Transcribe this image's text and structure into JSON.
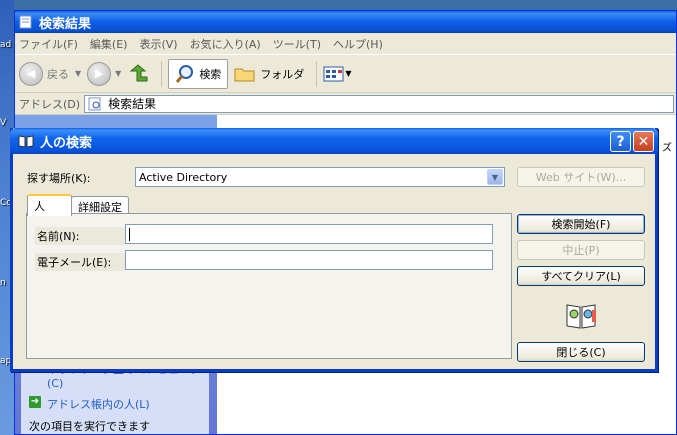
{
  "desktop": {
    "labels": [
      "ad",
      "V",
      "Cc",
      "n",
      "ap"
    ]
  },
  "explorer": {
    "title": "検索結果",
    "menu": [
      "ファイル(F)",
      "編集(E)",
      "表示(V)",
      "お気に入り(A)",
      "ツール(T)",
      "ヘルプ(H)"
    ],
    "toolbar": {
      "back": "戻る",
      "search": "検索",
      "folders": "フォルダ"
    },
    "address_label": "アドレス(D)",
    "address_value": "検索結果",
    "header_peek": "ズ",
    "tasks": [
      {
        "label": "ネットワーク上のコンピュータ (C)"
      },
      {
        "label": "アドレス帳内の人(L)"
      }
    ],
    "tasks_footer": "次の項目を実行できます"
  },
  "dialog": {
    "title": "人の検索",
    "help": "?",
    "close": "✕",
    "look_in_label": "探す場所(K):",
    "look_in_value": "Active Directory",
    "website_button": "Web サイト(W)...",
    "tabs": [
      "人",
      "詳細設定"
    ],
    "name_label": "名前(N):",
    "name_value": "",
    "email_label": "電子メール(E):",
    "email_value": "",
    "find_now": "検索開始(F)",
    "stop": "中止(P)",
    "clear_all": "すべてクリア(L)",
    "close_button": "閉じる(C)"
  },
  "colors": {
    "title_blue": "#0a5ce8",
    "dialog_face": "#ece9d8",
    "close_red": "#c4401f"
  }
}
